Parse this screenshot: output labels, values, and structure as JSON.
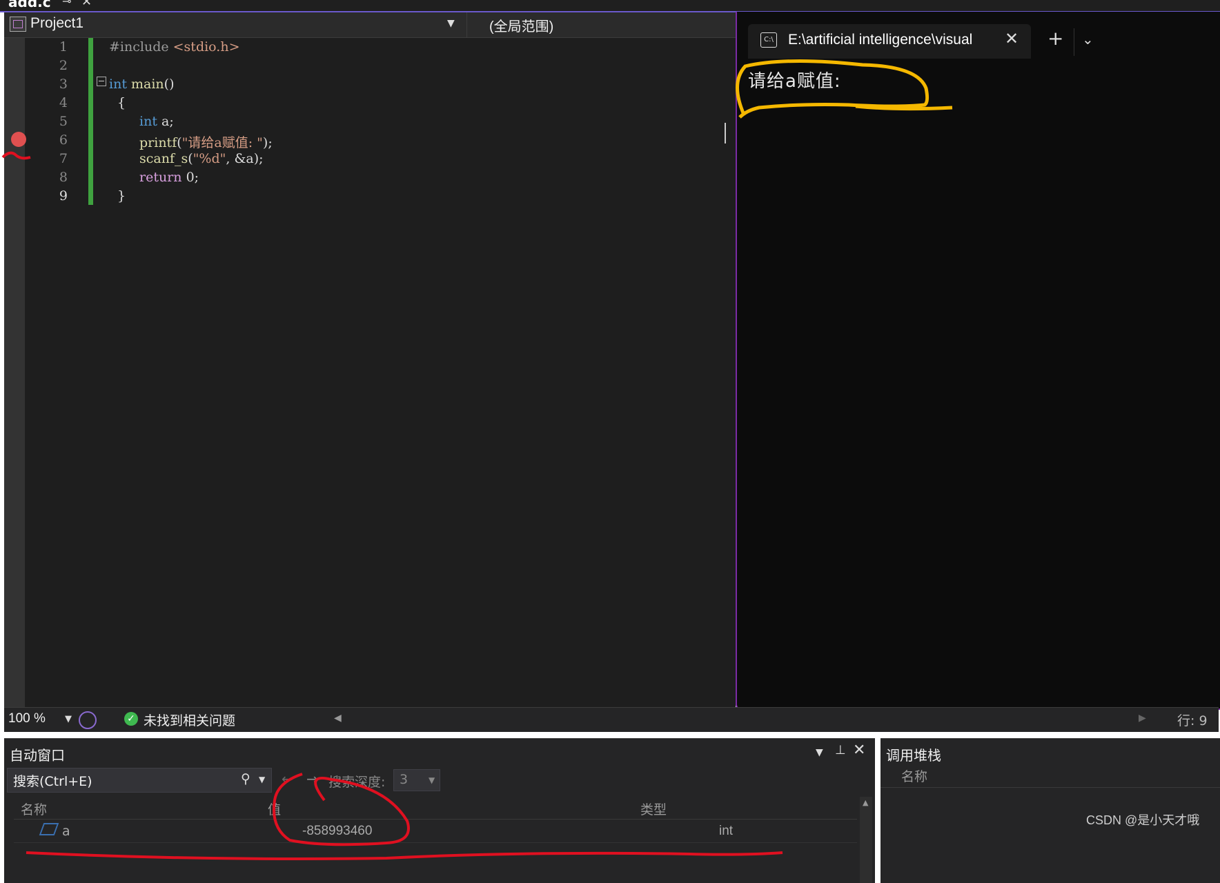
{
  "file_tab": {
    "title": "add.c"
  },
  "navbar": {
    "project": "Project1",
    "scope": "(全局范围)"
  },
  "editor": {
    "line_numbers": [
      "1",
      "2",
      "3",
      "4",
      "5",
      "6",
      "7",
      "8",
      "9"
    ],
    "lines": [
      {
        "parts": [
          {
            "c": "pp",
            "t": "#include "
          },
          {
            "c": "str",
            "t": "<stdio.h>"
          }
        ]
      },
      {
        "parts": []
      },
      {
        "parts": [
          {
            "c": "kw",
            "t": "int "
          },
          {
            "c": "fn",
            "t": "main"
          },
          {
            "c": "pl",
            "t": "()"
          }
        ]
      },
      {
        "parts": [
          {
            "c": "pl",
            "t": "{"
          }
        ]
      },
      {
        "parts": [
          {
            "c": "kw",
            "t": "int "
          },
          {
            "c": "pl",
            "t": "a;"
          }
        ]
      },
      {
        "parts": [
          {
            "c": "fn",
            "t": "printf"
          },
          {
            "c": "pl",
            "t": "("
          },
          {
            "c": "str",
            "t": "\"请给a赋值: \""
          },
          {
            "c": "pl",
            "t": ");"
          }
        ]
      },
      {
        "parts": [
          {
            "c": "fn",
            "t": "scanf_s"
          },
          {
            "c": "pl",
            "t": "("
          },
          {
            "c": "str",
            "t": "\"%d\""
          },
          {
            "c": "pl",
            "t": ", &a);"
          }
        ]
      },
      {
        "parts": [
          {
            "c": "purple",
            "t": "return "
          },
          {
            "c": "pl",
            "t": "0;"
          }
        ]
      },
      {
        "parts": [
          {
            "c": "pl",
            "t": "}"
          }
        ]
      }
    ],
    "breakpoint_line": 6
  },
  "statusbar": {
    "zoom": "100 %",
    "issues": "未找到相关问题",
    "row": "行: 9"
  },
  "terminal": {
    "tab_title": "E:\\artificial intelligence\\visual",
    "icon_text": "C:\\",
    "output": "请给a赋值:"
  },
  "autos": {
    "title": "自动窗口",
    "search_placeholder": "搜索(Ctrl+E)",
    "depth_label": "搜索深度:",
    "depth_value": "3",
    "columns": [
      "名称",
      "值",
      "类型"
    ],
    "rows": [
      {
        "name": "a",
        "value": "-858993460",
        "type": "int"
      }
    ]
  },
  "callstack": {
    "title": "调用堆栈",
    "column": "名称"
  },
  "watermark": "CSDN @是小天才哦",
  "colors": {
    "accent": "#6b5acd",
    "terminal_border": "#7a2ba5",
    "breakpoint": "#e05050",
    "annotation_red": "#e01020",
    "annotation_yellow": "#f5b800"
  }
}
